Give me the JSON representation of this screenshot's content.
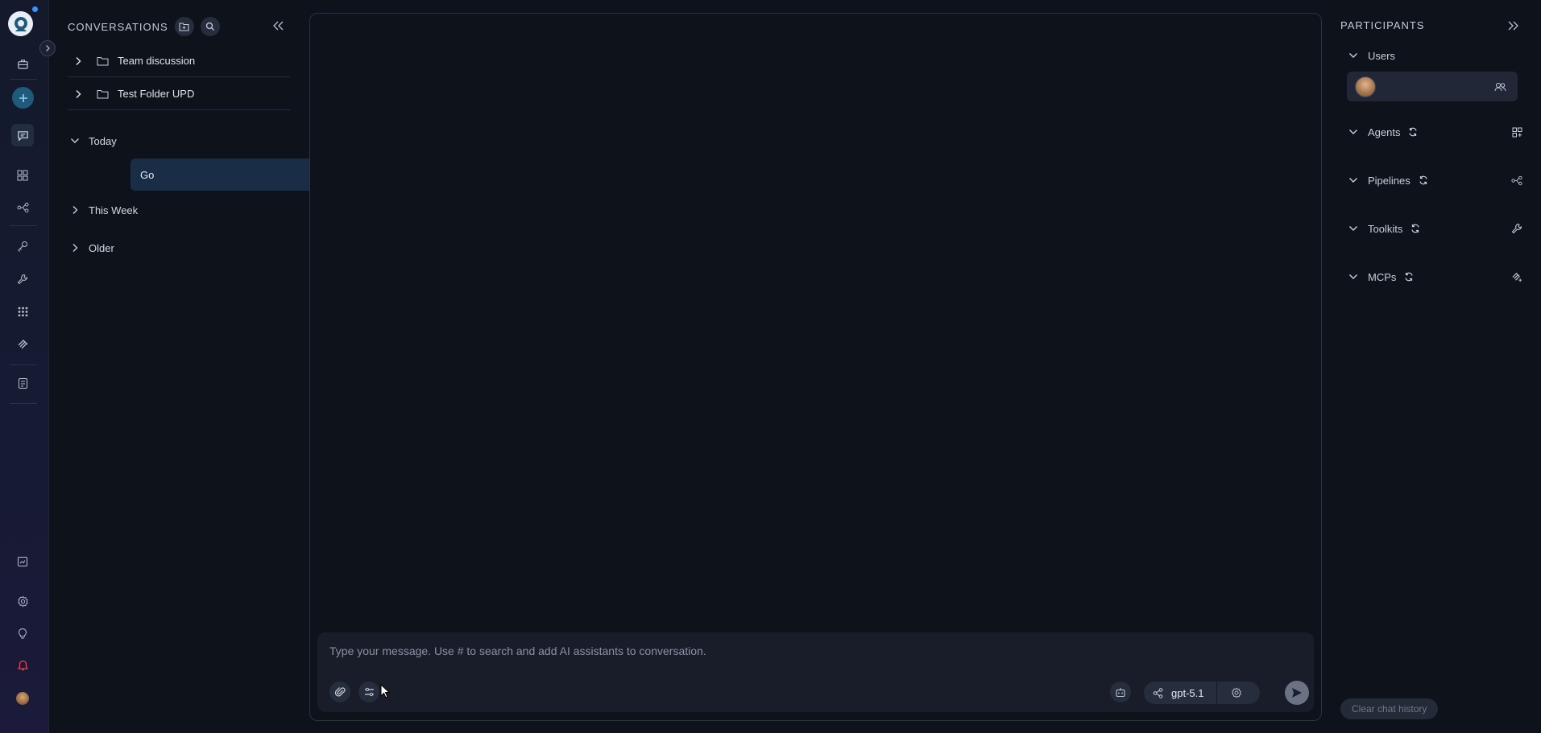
{
  "conversations": {
    "title": "CONVERSATIONS",
    "folders": [
      {
        "label": "Team discussion"
      },
      {
        "label": "Test Folder UPD"
      }
    ],
    "groups": {
      "today": "Today",
      "this_week": "This Week",
      "older": "Older"
    },
    "today_items": [
      {
        "label": "Go"
      }
    ]
  },
  "composer": {
    "placeholder": "Type your message. Use # to search and add AI assistants to conversation.",
    "model": "gpt-5.1"
  },
  "participants": {
    "title": "PARTICIPANTS",
    "sections": {
      "users": "Users",
      "agents": "Agents",
      "pipelines": "Pipelines",
      "toolkits": "Toolkits",
      "mcps": "MCPs"
    },
    "clear_label": "Clear chat history"
  },
  "colors": {
    "accent": "#3f90ff",
    "selected_item": "#1a2d46",
    "background": "#0e121b"
  }
}
